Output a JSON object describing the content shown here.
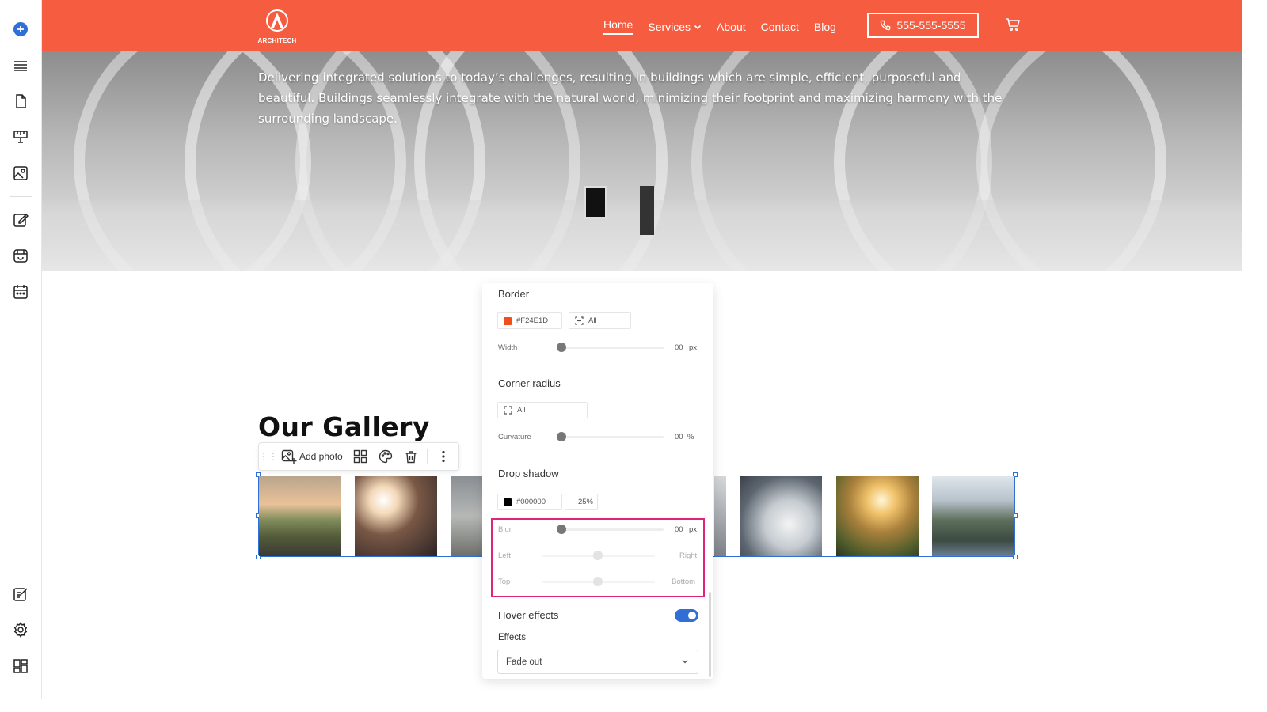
{
  "header": {
    "logo_text": "ARCHITECH",
    "nav": [
      {
        "label": "Home",
        "active": true
      },
      {
        "label": "Services",
        "dropdown": true
      },
      {
        "label": "About"
      },
      {
        "label": "Contact"
      },
      {
        "label": "Blog"
      }
    ],
    "phone": "555-555-5555",
    "accent": "#f65d40"
  },
  "hero": {
    "text": "Delivering integrated solutions to today’s challenges, resulting in buildings which are simple, efficient, purposeful and beautiful. Buildings seamlessly integrate with the natural world, minimizing their footprint and maximizing harmony with the surrounding landscape."
  },
  "gallery": {
    "title": "Our Gallery",
    "toolbar": {
      "add_photo": "Add photo"
    }
  },
  "panel": {
    "border": {
      "title": "Border",
      "color": "#F24E1D",
      "sides": "All",
      "width_label": "Width",
      "width_value": "00",
      "width_unit": "px"
    },
    "corner": {
      "title": "Corner radius",
      "sides": "All",
      "curvature_label": "Curvature",
      "curvature_value": "00",
      "curvature_unit": "%"
    },
    "shadow": {
      "title": "Drop shadow",
      "color": "#000000",
      "opacity": "25%",
      "blur_label": "Blur",
      "blur_value": "00",
      "blur_unit": "px",
      "left_label": "Left",
      "right_label": "Right",
      "top_label": "Top",
      "bottom_label": "Bottom"
    },
    "hover": {
      "title": "Hover effects",
      "enabled": true,
      "effects_label": "Effects",
      "effects_value": "Fade out"
    }
  }
}
